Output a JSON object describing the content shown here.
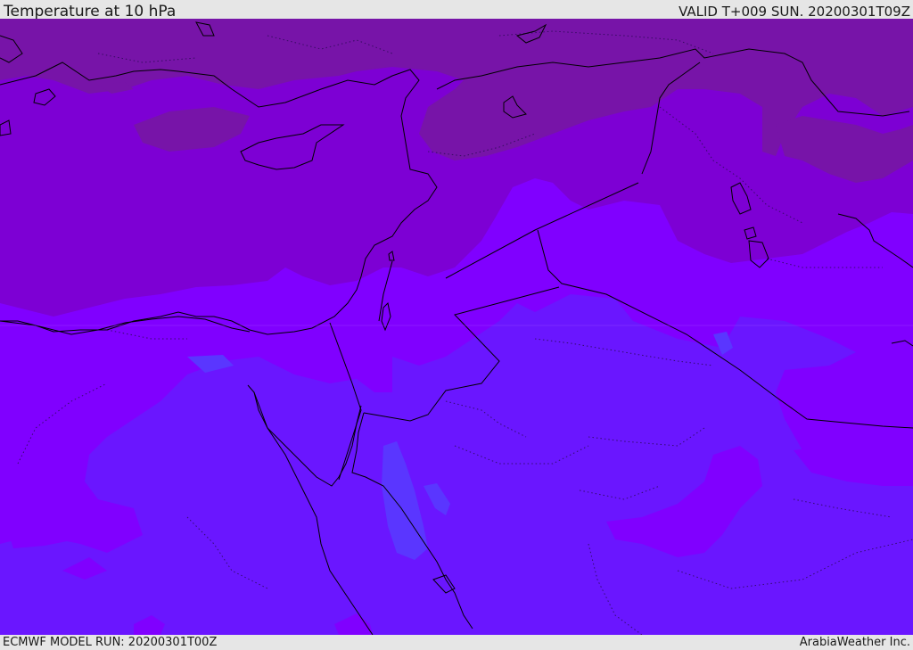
{
  "header": {
    "title": "Temperature at 10 hPa",
    "valid": "VALID T+009 SUN. 20200301T09Z"
  },
  "footer": {
    "model_run": "ECMWF MODEL RUN: 20200301T00Z",
    "credit": "ArabiaWeather Inc."
  },
  "map": {
    "field": "Temperature at 10 hPa",
    "colors": {
      "band_coldest": "#7714a8",
      "band_cold": "#7d00d4",
      "band_mid": "#8000ff",
      "band_warm": "#6a16ff",
      "band_warmest": "#5a36ff",
      "coastline": "#000000"
    }
  }
}
